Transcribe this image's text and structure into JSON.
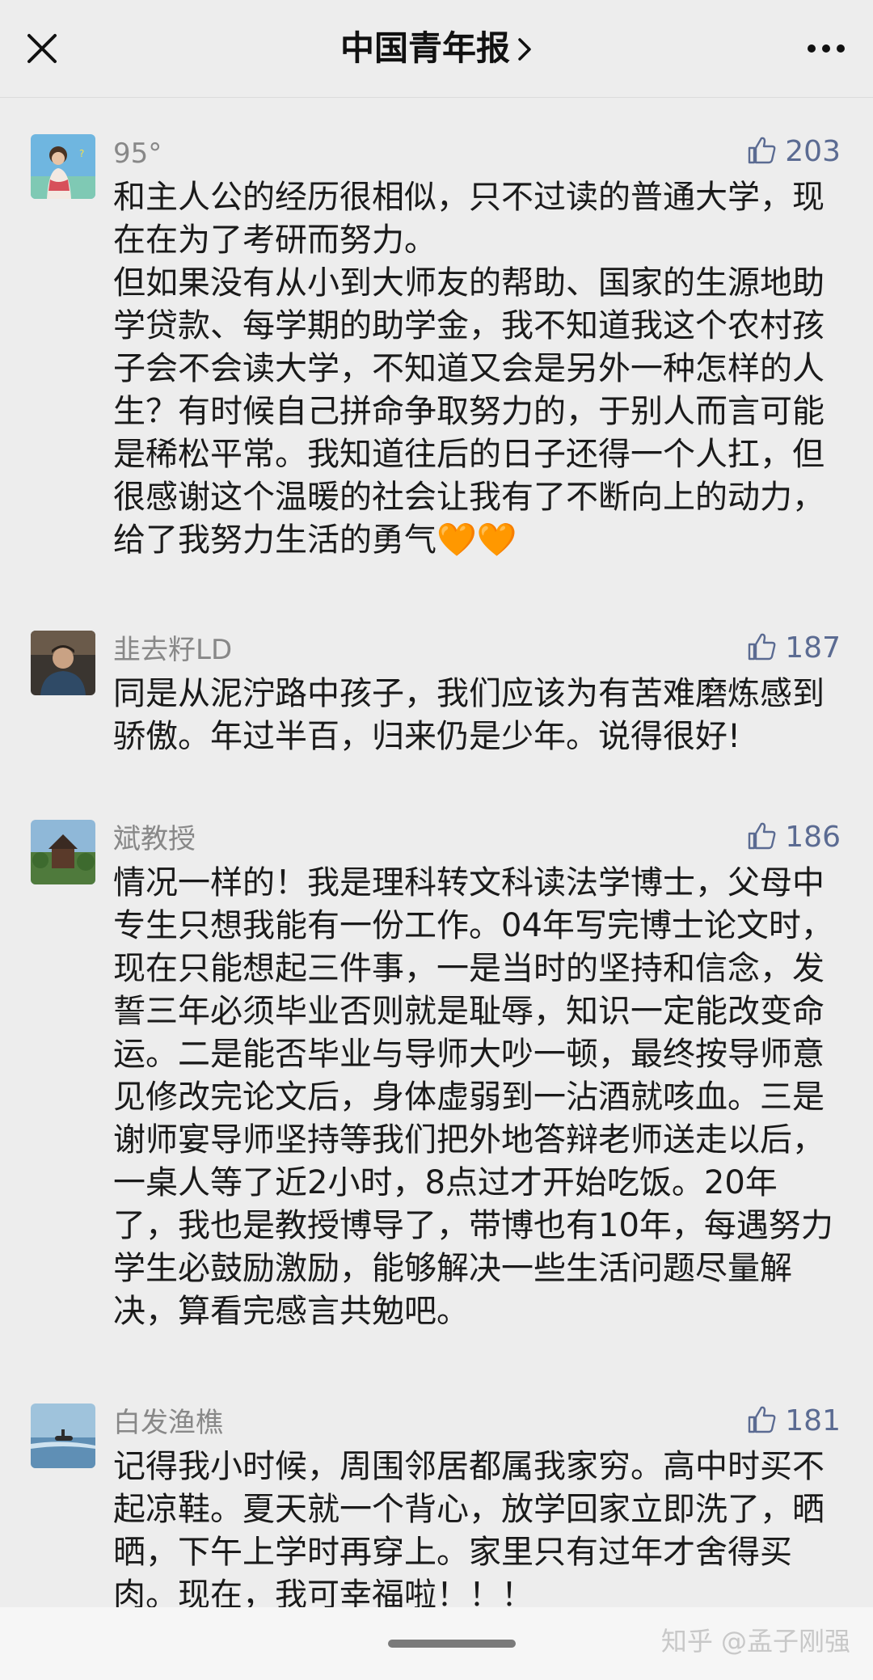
{
  "header": {
    "title": "中国青年报",
    "close_icon": "close-icon",
    "more_icon": "more-dots-icon"
  },
  "comments": [
    {
      "name": "95°",
      "likes": "203",
      "text": "和主人公的经历很相似，只不过读的普通大学，现\n在在为了考研而努力。\n但如果没有从小到大师友的帮助、国家的生源地助\n学贷款、每学期的助学金，我不知道我这个农村孩\n子会不会读大学，不知道又会是另外一种怎样的人\n生？有时候自己拼命争取努力的，于别人而言可能\n是稀松平常。我知道往后的日子还得一个人扛，但\n很感谢这个温暖的社会让我有了不断向上的动力，\n给了我努力生活的勇气🧡🧡"
    },
    {
      "name": "韭去籽LD",
      "likes": "187",
      "text": "同是从泥泞路中孩子，我们应该为有苦难磨炼感到\n骄傲。年过半百，归来仍是少年。说得很好!"
    },
    {
      "name": "斌教授",
      "likes": "186",
      "text": "情况一样的！我是理科转文科读法学博士，父母中\n专生只想我能有一份工作。04年写完博士论文时，\n现在只能想起三件事，一是当时的坚持和信念，发\n誓三年必须毕业否则就是耻辱，知识一定能改变命\n运。二是能否毕业与导师大吵一顿，最终按导师意\n见修改完论文后，身体虚弱到一沾酒就咳血。三是\n谢师宴导师坚持等我们把外地答辩老师送走以后，\n一桌人等了近2小时，8点过才开始吃饭。20年\n了，我也是教授博导了，带博也有10年，每遇努力\n学生必鼓励激励，能够解决一些生活问题尽量解\n决，算看完感言共勉吧。"
    },
    {
      "name": "白发渔樵",
      "likes": "181",
      "text": "记得我小时候，周围邻居都属我家穷。高中时买不\n起凉鞋。夏天就一个背心，放学回家立即洗了，晒\n晒，下午上学时再穿上。家里只有过年才舍得买\n肉。现在，我可幸福啦！！！"
    }
  ],
  "watermark": "知乎 @孟子刚强",
  "colors": {
    "background": "#ededed",
    "like_count": "#5b6b92",
    "nickname": "#888888",
    "text": "#1a1a1a"
  }
}
